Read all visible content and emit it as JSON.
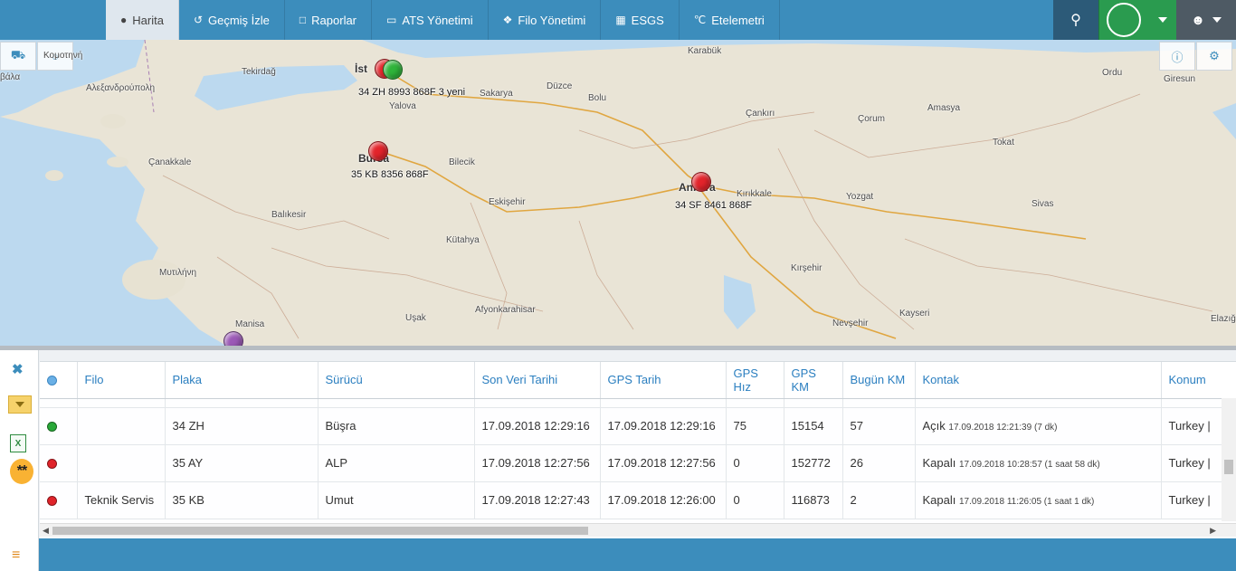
{
  "nav": {
    "tabs": [
      {
        "label": "Harita",
        "icon": "globe-icon",
        "glyph": "●"
      },
      {
        "label": "Geçmiş İzle",
        "icon": "history-icon",
        "glyph": "↺"
      },
      {
        "label": "Raporlar",
        "icon": "file-icon",
        "glyph": "□"
      },
      {
        "label": "ATS Yönetimi",
        "icon": "monitor-icon",
        "glyph": "▭"
      },
      {
        "label": "Filo Yönetimi",
        "icon": "cubes-icon",
        "glyph": "❖"
      },
      {
        "label": "ESGS",
        "icon": "grid-icon",
        "glyph": "▦"
      },
      {
        "label": "Etelemetri",
        "icon": "temperature-icon",
        "glyph": "℃"
      }
    ],
    "search_icon": "⚲",
    "user_icon": "☻",
    "status_color": "#2a9b4f"
  },
  "map": {
    "labels": {
      "istanbul": "İst",
      "tekirdag": "Tekirdağ",
      "alex": "Αλεξανδρούπολη",
      "komotini": "Κομοτηνή",
      "vala": "βάλα",
      "yalova": "Yalova",
      "sakarya": "Sakarya",
      "duzce": "Düzce",
      "bolu": "Bolu",
      "karabuk": "Karabük",
      "cankiri": "Çankırı",
      "corum": "Çorum",
      "amasya": "Amasya",
      "tokat": "Tokat",
      "ordu": "Ordu",
      "giresun": "Giresun",
      "canakkale": "Çanakkale",
      "bursa": "Bursa",
      "bilecik": "Bilecik",
      "eskisehir": "Eskişehir",
      "ankara": "Ankara",
      "kirikkale": "Kırıkkale",
      "yozgat": "Yozgat",
      "sivas": "Sivas",
      "balikesir": "Balıkesir",
      "kutahya": "Kütahya",
      "kirsehir": "Kırşehir",
      "mytilini": "Μυτιλήνη",
      "afyon": "Afyonkarahisar",
      "usak": "Uşak",
      "nevsehir": "Nevşehir",
      "kayseri": "Kayseri",
      "manisa": "Manisa",
      "elazig": "Elazığ"
    },
    "vehicle_labels": {
      "istanbul": "34 ZH 8993 868F",
      "istanbul_overlap": "3 yeni",
      "bursa": "35 KB 8356 868F",
      "ankara": "34 SF 8461 868F"
    },
    "marker_colors": {
      "red": "#e3242b",
      "green": "#2fb43a",
      "purple": "#9b59b6"
    },
    "left_tools": {
      "car_icon": "⛟",
      "circle_icon": "○"
    },
    "right_tools": {
      "info_icon": "ⓘ",
      "settings_icon": "⚙"
    }
  },
  "grid": {
    "columns": [
      "",
      "Filo",
      "Plaka",
      "Sürücü",
      "Son Veri Tarihi",
      "GPS Tarih",
      "GPS Hız",
      "GPS KM",
      "Bugün KM",
      "Kontak",
      "Konum"
    ],
    "rows": [
      {
        "status": "green",
        "filo": "",
        "plaka": "34 ZH",
        "surucu": "Büşra",
        "son_veri": "17.09.2018 12:29:16",
        "gps_tarih": "17.09.2018 12:29:16",
        "hiz": "75",
        "km": "15154",
        "bugun_km": "57",
        "kontak": "Açık",
        "kontak_detay": "17.09.2018 12:21:39 (7 dk)",
        "konum": "Turkey |"
      },
      {
        "status": "red",
        "filo": "",
        "plaka": "35 AY",
        "surucu": "ALP",
        "son_veri": "17.09.2018 12:27:56",
        "gps_tarih": "17.09.2018 12:27:56",
        "hiz": "0",
        "km": "152772",
        "bugun_km": "26",
        "kontak": "Kapalı",
        "kontak_detay": "17.09.2018 10:28:57 (1 saat 58 dk)",
        "konum": "Turkey |"
      },
      {
        "status": "red",
        "filo": "Teknik Servis",
        "plaka": "35 KB",
        "surucu": "Umut",
        "son_veri": "17.09.2018 12:27:43",
        "gps_tarih": "17.09.2018 12:26:00",
        "hiz": "0",
        "km": "116873",
        "bugun_km": "2",
        "kontak": "Kapalı",
        "kontak_detay": "17.09.2018 11:26:05 (1 saat 1 dk)",
        "konum": "Turkey |"
      }
    ]
  },
  "left_tools": {
    "close": "✖",
    "excel": "X",
    "favorites": "**",
    "menu": "≡"
  }
}
